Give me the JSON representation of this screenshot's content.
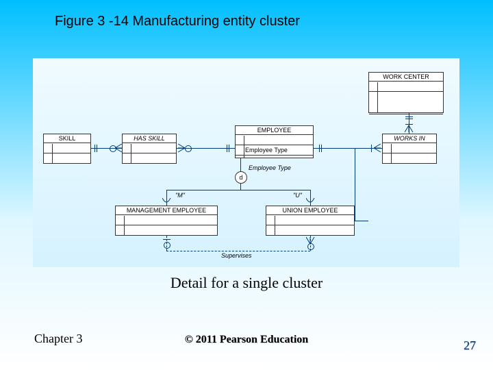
{
  "title": "Figure 3 -14 Manufacturing entity cluster",
  "subtitle": "Detail for a single cluster",
  "chapter": "Chapter 3",
  "copyright": "© 2011 Pearson Education",
  "page_number": "27",
  "entities": {
    "skill": {
      "name": "SKILL"
    },
    "has_skill": {
      "name": "HAS SKILL"
    },
    "employee": {
      "name": "EMPLOYEE",
      "attr1": "Employee Type",
      "discriminator": "Employee Type"
    },
    "work_center": {
      "name": "WORK CENTER"
    },
    "works_in": {
      "name": "WORKS IN"
    },
    "management_employee": {
      "name": "MANAGEMENT EMPLOYEE"
    },
    "union_employee": {
      "name": "UNION EMPLOYEE"
    },
    "supervises": {
      "name": "Supervises"
    },
    "d_symbol": "d",
    "subtype_m": "\"M\"",
    "subtype_u": "\"U\""
  },
  "chart_data": {
    "type": "erd",
    "title": "Manufacturing entity cluster — detail",
    "entities": [
      {
        "id": "SKILL",
        "type": "entity"
      },
      {
        "id": "HAS_SKILL",
        "type": "associative"
      },
      {
        "id": "EMPLOYEE",
        "type": "entity",
        "attributes": [
          "Employee Type"
        ]
      },
      {
        "id": "WORK_CENTER",
        "type": "entity"
      },
      {
        "id": "WORKS_IN",
        "type": "associative"
      },
      {
        "id": "MANAGEMENT_EMPLOYEE",
        "type": "subtype",
        "supertype": "EMPLOYEE",
        "discriminator_value": "M"
      },
      {
        "id": "UNION_EMPLOYEE",
        "type": "subtype",
        "supertype": "EMPLOYEE",
        "discriminator_value": "U"
      }
    ],
    "relationships": [
      {
        "from": "SKILL",
        "to": "HAS_SKILL",
        "from_card": "1..1",
        "to_card": "0..*"
      },
      {
        "from": "EMPLOYEE",
        "to": "HAS_SKILL",
        "from_card": "1..1",
        "to_card": "0..*"
      },
      {
        "from": "EMPLOYEE",
        "to": "WORKS_IN",
        "from_card": "1..1",
        "to_card": "1..*"
      },
      {
        "from": "WORK_CENTER",
        "to": "WORKS_IN",
        "from_card": "1..1",
        "to_card": "1..*"
      },
      {
        "name": "Supervises",
        "from": "MANAGEMENT_EMPLOYEE",
        "to": "UNION_EMPLOYEE",
        "from_card": "0..1",
        "to_card": "0..*"
      }
    ],
    "specialization": {
      "supertype": "EMPLOYEE",
      "completeness": "partial",
      "disjointness": "disjoint",
      "discriminator": "Employee Type",
      "subtypes": [
        "MANAGEMENT_EMPLOYEE",
        "UNION_EMPLOYEE"
      ]
    }
  }
}
